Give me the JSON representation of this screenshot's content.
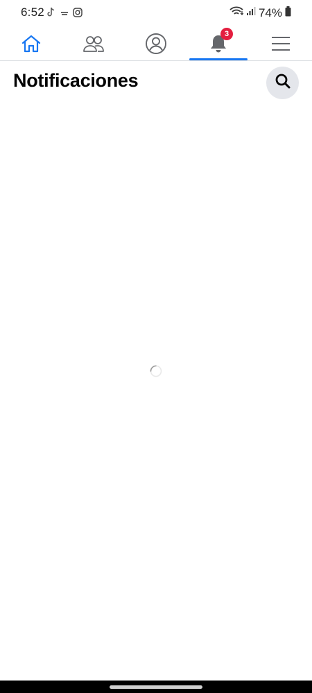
{
  "status_bar": {
    "time": "6:52",
    "battery": "74%",
    "notification_icons": [
      "tiktok-icon",
      "cast-icon",
      "instagram-icon"
    ]
  },
  "nav": {
    "items": [
      {
        "name": "home",
        "icon": "home-icon"
      },
      {
        "name": "friends",
        "icon": "friends-icon"
      },
      {
        "name": "profile",
        "icon": "profile-icon"
      },
      {
        "name": "notifications",
        "icon": "bell-icon",
        "active": true
      },
      {
        "name": "menu",
        "icon": "menu-icon"
      }
    ],
    "notifications_badge": "3"
  },
  "header": {
    "title": "Notificaciones"
  },
  "colors": {
    "accent": "#1877f2",
    "badge": "#e41e3f",
    "search_bg": "#e4e6eb"
  }
}
